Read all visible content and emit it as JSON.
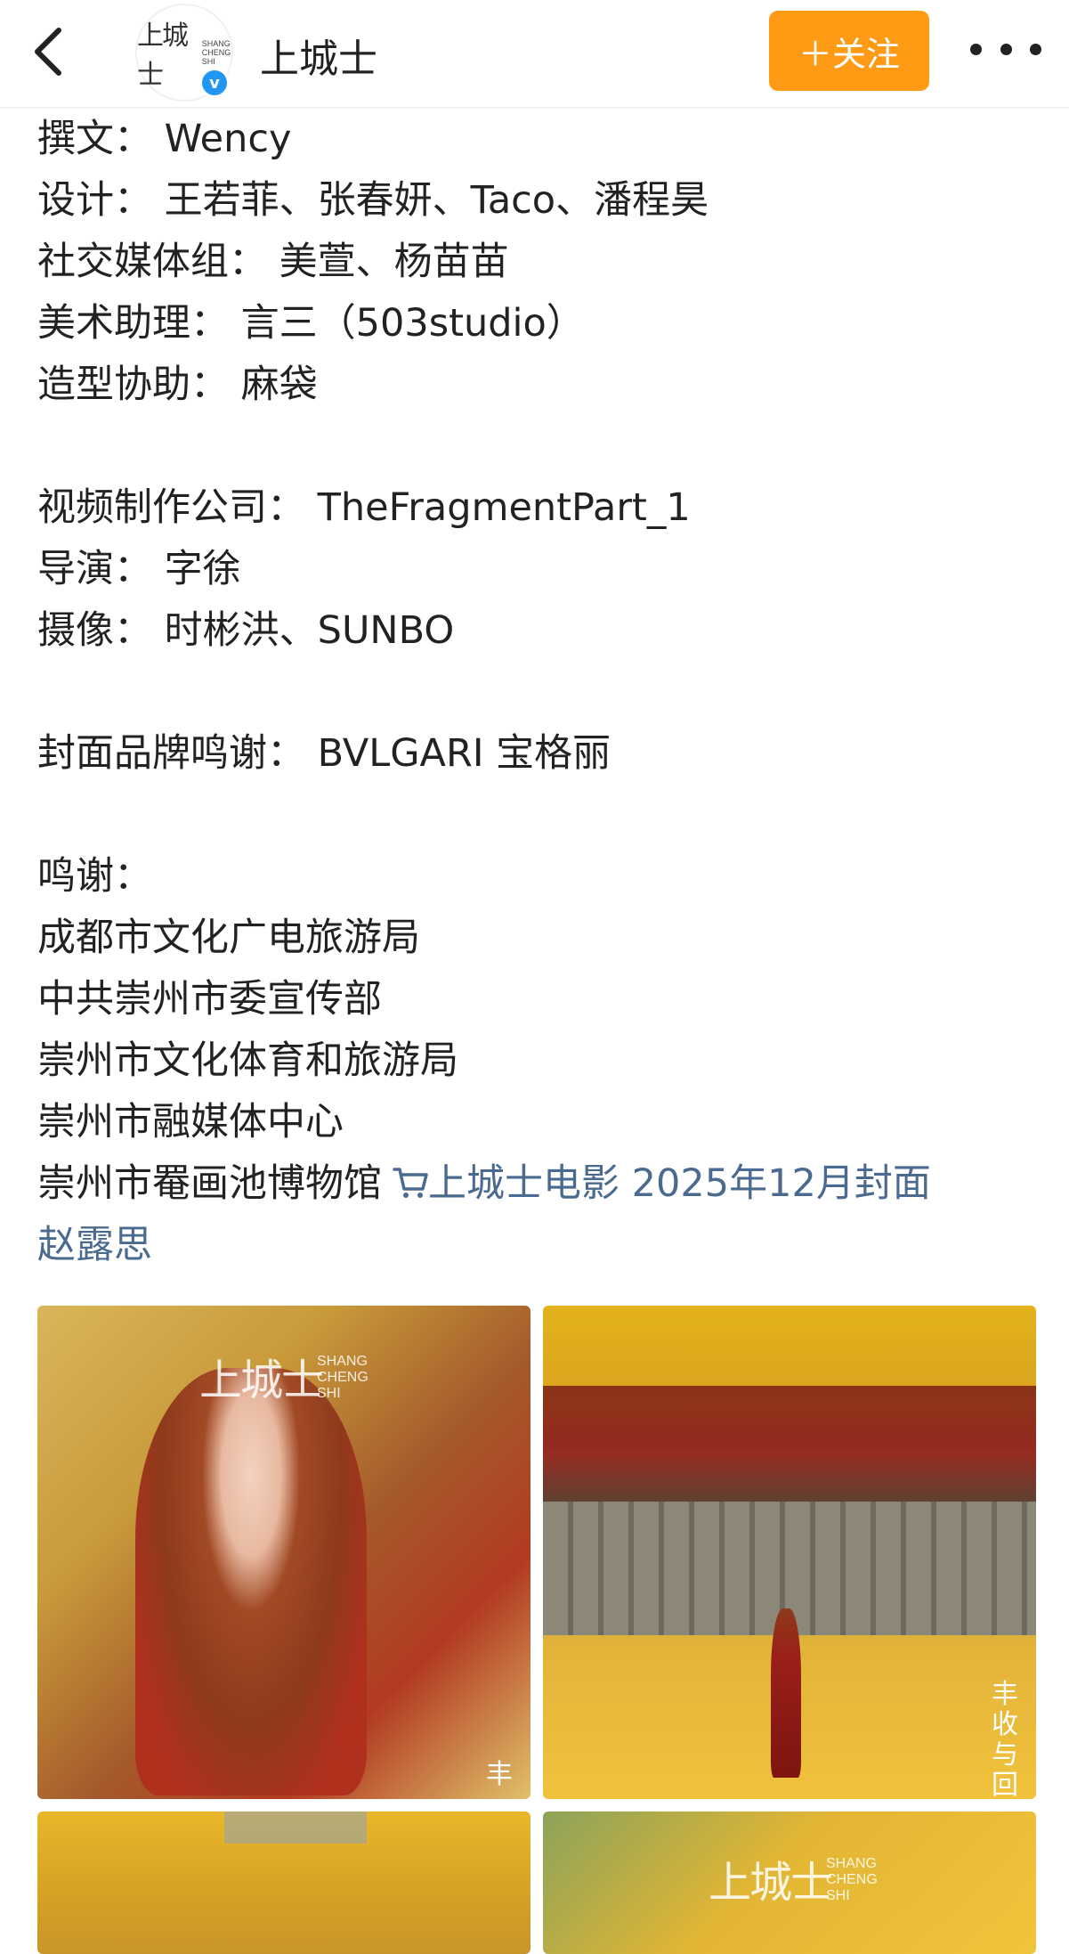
{
  "nav": {
    "back_icon": "chevron-left-icon",
    "account_name": "上城士",
    "avatar_logo": "上城士",
    "avatar_sub": "SHANG CHENG SHI",
    "verified_icon": "v",
    "follow_label": "＋关注",
    "more_icon": "more-dots-icon",
    "accent_color": "#ff9a14"
  },
  "post": {
    "lines": [
      "撰文：  Wency",
      "设计：  王若菲、张春妍、Taco、潘程昊",
      "社交媒体组：  美萱、杨苗苗",
      "美术助理：  言三（503studio）",
      "造型协助：  麻袋",
      "",
      "视频制作公司：  TheFragmentPart_1",
      "导演：  字徐",
      "摄像：  时彬洪、SUNBO",
      "",
      "封面品牌鸣谢：  BVLGARI 宝格丽",
      "",
      "鸣谢：",
      "成都市文化广电旅游局",
      "中共崇州市委宣传部",
      "崇州市文化体育和旅游局",
      "崇州市融媒体中心"
    ],
    "last_line_text": "崇州市罨画池博物馆",
    "product_link": "上城士电影 2025年12月封面",
    "product_link_cont": "赵露思",
    "link_color": "#4a6a8f"
  },
  "photos": {
    "p1_logo": "上城士",
    "p1_sub": "SHANG CHENG SHI",
    "p1_side": "丰",
    "p2_side": "丰收与回",
    "p4_logo": "上城士",
    "p4_sub": "SHANG CHENG SHI"
  }
}
